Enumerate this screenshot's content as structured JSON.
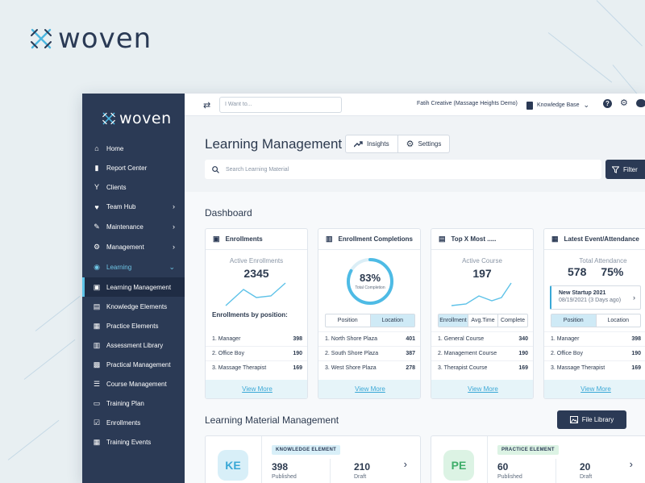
{
  "brand": {
    "name": "woven"
  },
  "sidebar": {
    "brand": "woven",
    "items": [
      {
        "label": "Home",
        "icon": "home-icon",
        "glyph": "⌂"
      },
      {
        "label": "Report Center",
        "icon": "book-icon",
        "glyph": "▮"
      },
      {
        "label": "Clients",
        "icon": "user-icon",
        "glyph": "Y"
      },
      {
        "label": "Team Hub",
        "icon": "heart-icon",
        "glyph": "♥"
      },
      {
        "label": "Maintenance",
        "icon": "wrench-icon",
        "glyph": "✎"
      },
      {
        "label": "Management",
        "icon": "gear-icon",
        "glyph": "⚙"
      },
      {
        "label": "Learning",
        "icon": "lightbulb-icon",
        "glyph": "◉"
      },
      {
        "label": "Learning Management",
        "icon": "id-card-icon",
        "glyph": "▣"
      },
      {
        "label": "Knowledge Elements",
        "icon": "open-book-icon",
        "glyph": "▤"
      },
      {
        "label": "Practice Elements",
        "icon": "document-icon",
        "glyph": "▦"
      },
      {
        "label": "Assessment Library",
        "icon": "clipboard-icon",
        "glyph": "▥"
      },
      {
        "label": "Practical Management",
        "icon": "grid-icon",
        "glyph": "▩"
      },
      {
        "label": "Course Management",
        "icon": "list-icon",
        "glyph": "☰"
      },
      {
        "label": "Training Plan",
        "icon": "screen-icon",
        "glyph": "▭"
      },
      {
        "label": "Enrollments",
        "icon": "check-square-icon",
        "glyph": "☑"
      },
      {
        "label": "Training Events",
        "icon": "calendar-icon",
        "glyph": "▦"
      }
    ]
  },
  "topbar": {
    "search_placeholder": "I Want to...",
    "org": "Fatih Creative (Massage Heights Demo)",
    "kb": "Knowledge Base"
  },
  "header": {
    "title": "Learning Management",
    "tabs": [
      "Insights",
      "Settings"
    ],
    "search_placeholder": "Search Learning Material",
    "filter": "Filter"
  },
  "dashboard": {
    "title": "Dashboard",
    "enrollments": {
      "title": "Enrollments",
      "label": "Active Enrollments",
      "value": "2345",
      "sub_head": "Enrollments by position:",
      "rows": [
        {
          "name": "1. Manager",
          "value": "398"
        },
        {
          "name": "2. Office Boy",
          "value": "190"
        },
        {
          "name": "3. Massage Therapist",
          "value": "169"
        }
      ],
      "more": "View More"
    },
    "completions": {
      "title": "Enrollment Completions",
      "percent": "83%",
      "percent_value": 83,
      "ring_label": "Total Completion",
      "seg": [
        "Position",
        "Location"
      ],
      "rows": [
        {
          "name": "1. North Shore Plaza",
          "value": "401"
        },
        {
          "name": "2. South Shore Plaza",
          "value": "387"
        },
        {
          "name": "3. West Shore Plaza",
          "value": "278"
        }
      ],
      "more": "View More"
    },
    "topx": {
      "title": "Top X Most .....",
      "label": "Active Course",
      "value": "197",
      "seg": [
        "Enrollment",
        "Avg.Time",
        "Complete"
      ],
      "rows": [
        {
          "name": "1. General Course",
          "value": "340"
        },
        {
          "name": "2. Management Course",
          "value": "190"
        },
        {
          "name": "3. Therapist Course",
          "value": "169"
        }
      ],
      "more": "View More"
    },
    "latest": {
      "title": "Latest Event/Attendance",
      "label": "Total Attendance",
      "value": "578",
      "percent": "75%",
      "event_title": "New Startup 2021",
      "event_date": "08/19/2021 (3 Days ago)",
      "seg": [
        "Position",
        "Location"
      ],
      "rows": [
        {
          "name": "1. Manager",
          "value": "398"
        },
        {
          "name": "2. Office Boy",
          "value": "190"
        },
        {
          "name": "3. Massage Therapist",
          "value": "169"
        }
      ],
      "more": "View More"
    }
  },
  "lmm": {
    "title": "Learning Material Management",
    "file_library": "File Library",
    "cards": [
      {
        "badge": "KE",
        "tag": "KNOWLEDGE ELEMENT",
        "published": "398",
        "published_label": "Published",
        "draft": "210",
        "draft_label": "Draft"
      },
      {
        "badge": "PE",
        "tag": "PRACTICE ELEMENT",
        "published": "60",
        "published_label": "Published",
        "draft": "20",
        "draft_label": "Draft"
      }
    ]
  },
  "colors": {
    "accent": "#3aa8d6",
    "navy": "#2b3a55",
    "ke_bg": "#d8eff8",
    "pe_bg": "#dcf3e4"
  }
}
